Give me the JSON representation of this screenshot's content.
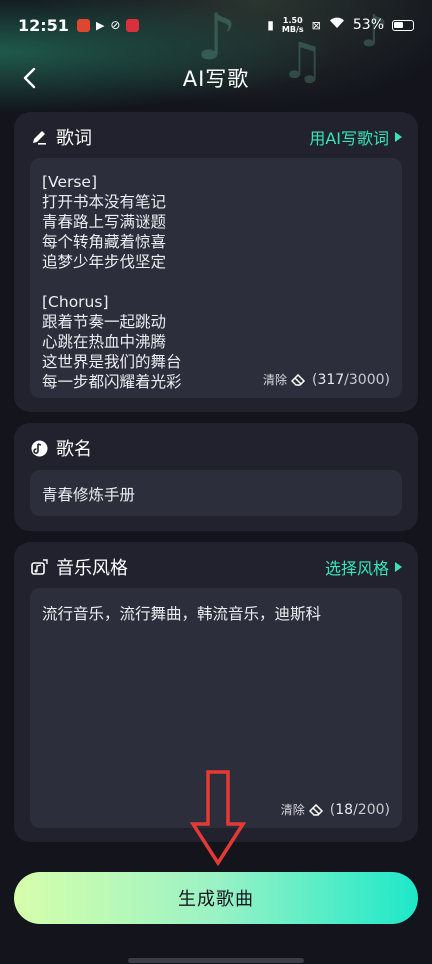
{
  "status_bar": {
    "time": "12:51",
    "net_speed_value": "1.50",
    "net_speed_unit": "MB/s",
    "battery": "53%"
  },
  "nav": {
    "title": "AI写歌"
  },
  "lyrics_section": {
    "title": "歌词",
    "ai_link": "用AI写歌词",
    "lines": [
      "[Verse]",
      "打开书本没有笔记",
      "青春路上写满谜题",
      "每个转角藏着惊喜",
      "追梦少年步伐坚定",
      "",
      "[Chorus]",
      "跟着节奏一起跳动",
      "心跳在热血中沸腾",
      "这世界是我们的舞台",
      "每一步都闪耀着光彩"
    ],
    "clear_label": "清除",
    "count": "317",
    "max": "/3000"
  },
  "song_name_section": {
    "title": "歌名",
    "value": "青春修炼手册"
  },
  "style_section": {
    "title": "音乐风格",
    "select_link": "选择风格",
    "value": "流行音乐，流行舞曲，韩流音乐，迪斯科",
    "clear_label": "清除",
    "count": "18",
    "max": "/200"
  },
  "generate_button": {
    "label": "生成歌曲"
  },
  "colors": {
    "accent": "#37e6b6",
    "background": "#13141c",
    "card": "#21222e",
    "field": "#2d2e3b",
    "annotation_arrow": "#e53935"
  }
}
